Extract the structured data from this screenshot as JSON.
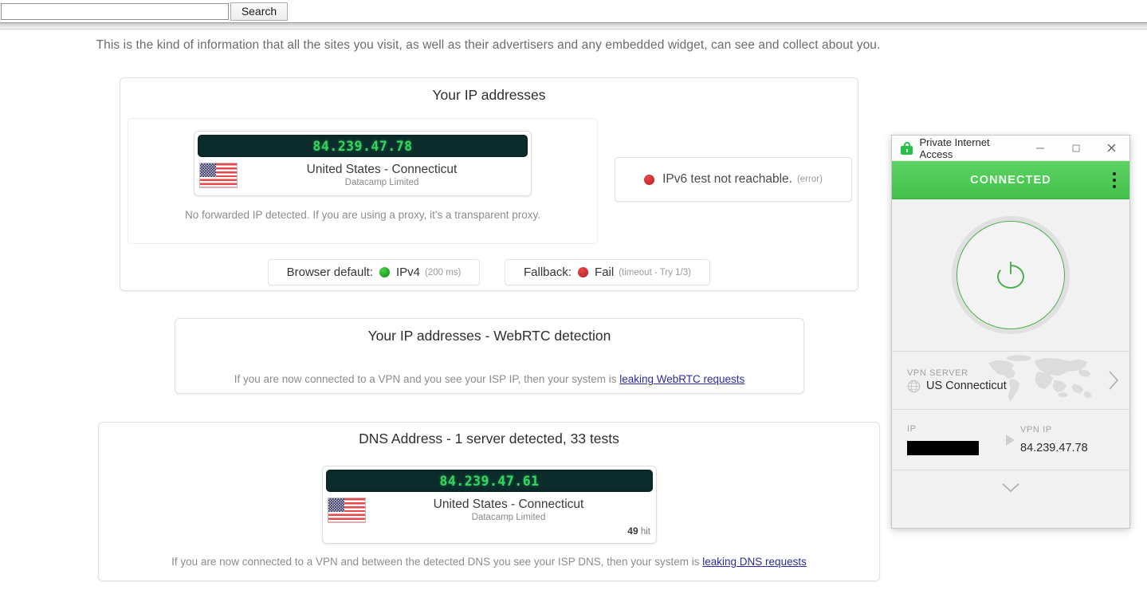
{
  "search": {
    "value": "",
    "placeholder": "",
    "button_label": "Search"
  },
  "intro_text": "This is the kind of information that all the sites you visit, as well as their advertisers and any embedded widget, can see and collect about you.",
  "ip_card": {
    "title": "Your IP addresses",
    "primary": {
      "ip": "84.239.47.78",
      "country": "United States - Connecticut",
      "isp": "Datacamp Limited",
      "flag": "us-flag-icon"
    },
    "forwarded_note": "No forwarded IP detected. If you are using a proxy, it's a transparent proxy.",
    "ipv6": {
      "status_icon": "red-status-dot",
      "text": "IPv6 test not reachable.",
      "detail": "(error)"
    },
    "browser_default": {
      "label": "Browser default:",
      "status_icon": "green-status-dot",
      "value": "IPv4",
      "detail": "(200 ms)"
    },
    "fallback": {
      "label": "Fallback:",
      "status_icon": "red-status-dot",
      "value": "Fail",
      "detail": "(timeout - Try 1/3)"
    }
  },
  "webrtc_card": {
    "title": "Your IP addresses - WebRTC detection",
    "note_before": "If you are now connected to a VPN and you see your ISP IP, then your system is ",
    "note_link": "leaking WebRTC requests"
  },
  "dns_card": {
    "title": "DNS Address - 1 server detected, 33 tests",
    "server": {
      "ip": "84.239.47.61",
      "country": "United States - Connecticut",
      "isp": "Datacamp Limited",
      "hit_count": "49",
      "hit_label": "hit",
      "flag": "us-flag-icon"
    },
    "note_before": "If you are now connected to a VPN and between the detected DNS you see your ISP DNS, then your system is ",
    "note_link": "leaking DNS requests"
  },
  "pia_window": {
    "title": "Private Internet Access",
    "lock_icon": "lock-icon",
    "minimize_label": "—",
    "maximize_label": "□",
    "close_label": "✕",
    "status": "CONNECTED",
    "menu_icon": "kebab-menu-icon",
    "power_icon": "power-button-icon",
    "vpn_server_label": "VPN SERVER",
    "vpn_server_name": "US Connecticut",
    "server_icon": "globe-icon",
    "chevron_right_icon": "chevron-right-icon",
    "ip_label": "IP",
    "ip_value": "",
    "vpn_ip_label": "VPN IP",
    "vpn_ip_value": "84.239.47.78",
    "arrow_icon": "arrow-right-icon",
    "expand_icon": "chevron-down-icon"
  },
  "colors": {
    "connected_green": "#43c24b",
    "led_green": "#35d45e",
    "led_background": "#0c2c2c",
    "error_red": "#b71c1c",
    "link_blue": "#2b2b9e"
  }
}
